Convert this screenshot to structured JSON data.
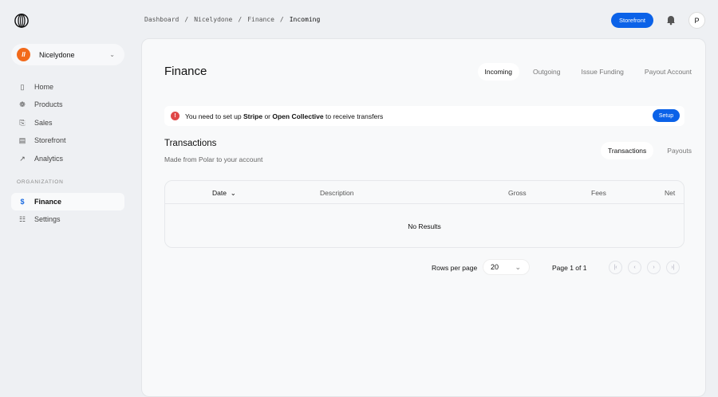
{
  "breadcrumb": [
    "Dashboard",
    "Nicelydone",
    "Finance",
    "Incoming"
  ],
  "header": {
    "storefront": "Storefront",
    "avatar": "P"
  },
  "org": {
    "name": "Nicelydone",
    "initial": "II"
  },
  "nav": [
    {
      "label": "Home",
      "icon": "▯"
    },
    {
      "label": "Products",
      "icon": "❁"
    },
    {
      "label": "Sales",
      "icon": "⎘"
    },
    {
      "label": "Storefront",
      "icon": "▤"
    },
    {
      "label": "Analytics",
      "icon": "↗"
    }
  ],
  "section": "ORGANIZATION",
  "org_nav": [
    {
      "label": "Finance",
      "icon": "$"
    },
    {
      "label": "Settings",
      "icon": "☷"
    }
  ],
  "page": {
    "title": "Finance",
    "tabs": [
      "Incoming",
      "Outgoing",
      "Issue Funding",
      "Payout Account"
    ]
  },
  "alert": {
    "pre": "You need to set up ",
    "b1": "Stripe",
    "mid": " or ",
    "b2": "Open Collective",
    "post": " to receive transfers",
    "button": "Setup"
  },
  "transactions": {
    "title": "Transactions",
    "subtitle": "Made from Polar to your account",
    "tabs": [
      "Transactions",
      "Payouts"
    ],
    "columns": [
      "Date",
      "Description",
      "Gross",
      "Fees",
      "Net"
    ],
    "empty": "No Results"
  },
  "pagination": {
    "rows_label": "Rows per page",
    "rows_value": "20",
    "page_label": "Page 1 of 1"
  }
}
